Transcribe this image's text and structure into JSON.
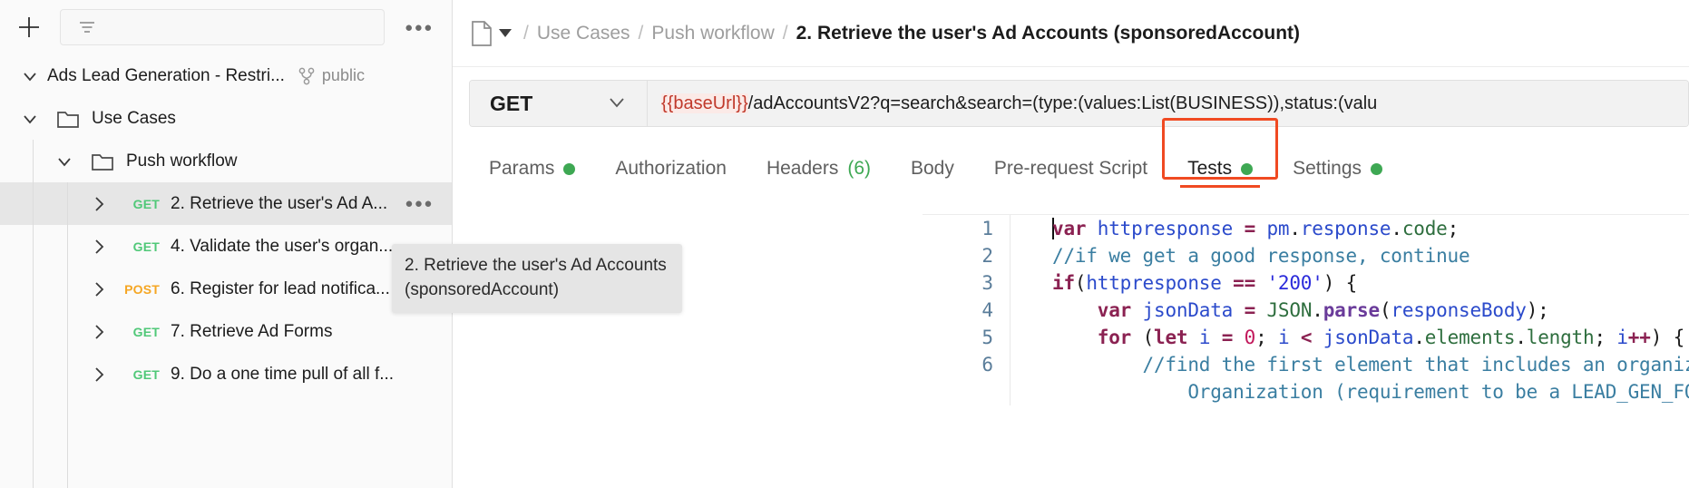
{
  "sidebar": {
    "new_button_icon": "plus-icon",
    "filter_icon": "filter-icon",
    "filter_placeholder": "",
    "more_actions_label": "●●●",
    "collection": {
      "name": "Ads Lead Generation - Restri...",
      "visibility": "public",
      "fork_icon": "fork-icon"
    },
    "tree": [
      {
        "type": "folder",
        "label": "Use Cases",
        "depth": 1,
        "expanded": true
      },
      {
        "type": "folder",
        "label": "Push workflow",
        "depth": 2,
        "expanded": true
      },
      {
        "type": "request",
        "method": "GET",
        "label": "2. Retrieve the user's Ad A...",
        "depth": 3,
        "selected": true,
        "more": "●●●"
      },
      {
        "type": "request",
        "method": "GET",
        "label": "4. Validate the user's organ...",
        "depth": 3,
        "selected": false
      },
      {
        "type": "request",
        "method": "POST",
        "label": "6. Register for lead notifica...",
        "depth": 3,
        "selected": false
      },
      {
        "type": "request",
        "method": "GET",
        "label": "7. Retrieve Ad Forms",
        "depth": 3,
        "selected": false
      },
      {
        "type": "request",
        "method": "GET",
        "label": "9. Do a one time pull of all f...",
        "depth": 3,
        "selected": false
      }
    ]
  },
  "breadcrumb": {
    "doc_icon": "document-icon",
    "caret_icon": "chevron-down-icon",
    "separator": "/",
    "items": [
      {
        "label": "Use Cases",
        "current": false
      },
      {
        "label": "Push workflow",
        "current": false
      },
      {
        "label": "2. Retrieve the user's Ad Accounts (sponsoredAccount)",
        "current": true
      }
    ]
  },
  "request": {
    "method": "GET",
    "method_caret_icon": "chevron-down-icon",
    "url_variable": "{{baseUrl}}",
    "url_rest": "/adAccountsV2?q=search&search=(type:(values:List(BUSINESS)),status:(valu"
  },
  "tabs": [
    {
      "label": "Params",
      "badge_dot": true,
      "active": false
    },
    {
      "label": "Authorization",
      "active": false
    },
    {
      "label": "Headers",
      "count": "(6)",
      "active": false
    },
    {
      "label": "Body",
      "active": false
    },
    {
      "label": "Pre-request Script",
      "active": false
    },
    {
      "label": "Tests",
      "badge_dot": true,
      "active": true,
      "highlighted": true
    },
    {
      "label": "Settings",
      "badge_dot": true,
      "active": false
    }
  ],
  "tooltip": {
    "text": "2. Retrieve the user's Ad Accounts (sponsoredAccount)"
  },
  "editor": {
    "lines": [
      {
        "num": "1",
        "segments": [
          {
            "t": "cursor",
            "v": ""
          },
          {
            "t": "kw",
            "v": "var"
          },
          {
            "t": "plain",
            "v": " "
          },
          {
            "t": "id",
            "v": "httpresponse"
          },
          {
            "t": "plain",
            "v": " "
          },
          {
            "t": "op",
            "v": "="
          },
          {
            "t": "plain",
            "v": " "
          },
          {
            "t": "id",
            "v": "pm"
          },
          {
            "t": "plain",
            "v": "."
          },
          {
            "t": "prop",
            "v": "response"
          },
          {
            "t": "plain",
            "v": "."
          },
          {
            "t": "obj",
            "v": "code"
          },
          {
            "t": "plain",
            "v": ";"
          }
        ]
      },
      {
        "num": "2",
        "segments": [
          {
            "t": "cmt",
            "v": "//if we get a good response, continue"
          }
        ]
      },
      {
        "num": "3",
        "segments": [
          {
            "t": "kw",
            "v": "if"
          },
          {
            "t": "plain",
            "v": "("
          },
          {
            "t": "id",
            "v": "httpresponse"
          },
          {
            "t": "plain",
            "v": " "
          },
          {
            "t": "op",
            "v": "=="
          },
          {
            "t": "plain",
            "v": " "
          },
          {
            "t": "str",
            "v": "'200'"
          },
          {
            "t": "plain",
            "v": ") {"
          }
        ]
      },
      {
        "num": "4",
        "segments": [
          {
            "t": "plain",
            "v": "    "
          },
          {
            "t": "kw",
            "v": "var"
          },
          {
            "t": "plain",
            "v": " "
          },
          {
            "t": "id",
            "v": "jsonData"
          },
          {
            "t": "plain",
            "v": " "
          },
          {
            "t": "op",
            "v": "="
          },
          {
            "t": "plain",
            "v": " "
          },
          {
            "t": "obj",
            "v": "JSON"
          },
          {
            "t": "plain",
            "v": "."
          },
          {
            "t": "meth",
            "v": "parse"
          },
          {
            "t": "plain",
            "v": "("
          },
          {
            "t": "id",
            "v": "responseBody"
          },
          {
            "t": "plain",
            "v": ");"
          }
        ]
      },
      {
        "num": "5",
        "segments": [
          {
            "t": "plain",
            "v": "    "
          },
          {
            "t": "kw",
            "v": "for"
          },
          {
            "t": "plain",
            "v": " ("
          },
          {
            "t": "kw2",
            "v": "let"
          },
          {
            "t": "plain",
            "v": " "
          },
          {
            "t": "id",
            "v": "i"
          },
          {
            "t": "plain",
            "v": " "
          },
          {
            "t": "op",
            "v": "="
          },
          {
            "t": "plain",
            "v": " "
          },
          {
            "t": "num",
            "v": "0"
          },
          {
            "t": "plain",
            "v": "; "
          },
          {
            "t": "id",
            "v": "i"
          },
          {
            "t": "plain",
            "v": " "
          },
          {
            "t": "op",
            "v": "<"
          },
          {
            "t": "plain",
            "v": " "
          },
          {
            "t": "id",
            "v": "jsonData"
          },
          {
            "t": "plain",
            "v": "."
          },
          {
            "t": "obj",
            "v": "elements"
          },
          {
            "t": "plain",
            "v": "."
          },
          {
            "t": "obj",
            "v": "length"
          },
          {
            "t": "plain",
            "v": "; "
          },
          {
            "t": "id",
            "v": "i"
          },
          {
            "t": "op",
            "v": "++"
          },
          {
            "t": "plain",
            "v": ") {"
          }
        ]
      },
      {
        "num": "6",
        "segments": [
          {
            "t": "plain",
            "v": "        "
          },
          {
            "t": "cmt",
            "v": "//find the first element that includes an organization urn as the refer"
          }
        ]
      },
      {
        "num": "",
        "segments": [
          {
            "t": "plain",
            "v": "            "
          },
          {
            "t": "cmt",
            "v": "Organization (requirement to be a LEAD_GEN_FORM_ADMIN on the compan"
          }
        ]
      }
    ]
  },
  "colors": {
    "accent_red": "#f04a22",
    "get_green": "#50c878",
    "post_orange": "#f5a623",
    "status_dot": "#3ea853",
    "selected_row": "#e6e6e6",
    "sidebar_bg": "#fafafa"
  }
}
